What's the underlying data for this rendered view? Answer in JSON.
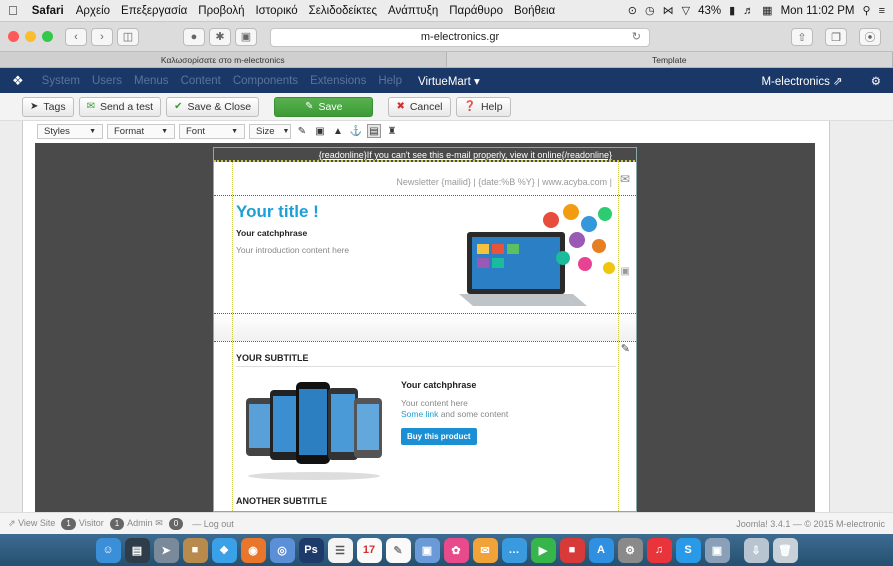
{
  "mac_menu": {
    "app": "Safari",
    "items": [
      "Αρχείο",
      "Επεξεργασία",
      "Προβολή",
      "Ιστορικό",
      "Σελιδοδείκτες",
      "Ανάπτυξη",
      "Παράθυρο",
      "Βοήθεια"
    ],
    "battery": "43%",
    "clock": "Mon 11:02 PM"
  },
  "browser": {
    "url": "m-electronics.gr",
    "tabs": [
      "Καλωσορίσατε στο m-electronics",
      "Template"
    ]
  },
  "joomla_nav": {
    "items": [
      "System",
      "Users",
      "Menus",
      "Content",
      "Components",
      "Extensions",
      "Help"
    ],
    "active": "VirtueMart",
    "site": "M-electronics"
  },
  "joomla_toolbar": {
    "tags": "Tags",
    "send_test": "Send a test",
    "save_close": "Save & Close",
    "save": "Save",
    "cancel": "Cancel",
    "help": "Help"
  },
  "editor_toolbar": {
    "styles": "Styles",
    "format": "Format",
    "font": "Font",
    "size": "Size"
  },
  "newsletter": {
    "readonline": "{readonline}If you can't see this e-mail properly, view it online{/readonline}",
    "header": "Newsletter {mailid} | {date:%B %Y} | www.acyba.com |",
    "title": "Your title !",
    "catchphrase": "Your catchphrase",
    "intro": "Your introduction content here",
    "subtitle1": "YOUR SUBTITLE",
    "product_catchphrase": "Your catchphrase",
    "product_content": "Your content here",
    "product_link": "Some link",
    "product_link_rest": " and some content",
    "buy_button": "Buy this product",
    "subtitle2": "ANOTHER SUBTITLE"
  },
  "status_bar": {
    "view_site": "View Site",
    "visitor_count": "1",
    "visitor": "Visitor",
    "admin_count": "1",
    "admin": "Admin",
    "msg_count": "0",
    "logout": "Log out",
    "version": "Joomla! 3.4.1 — © 2015 M-electronic"
  },
  "colors": {
    "joomla_nav": "#1a3867",
    "save_green": "#46a33e",
    "title_blue": "#1ba0d8",
    "dock": "#2f5f82"
  }
}
